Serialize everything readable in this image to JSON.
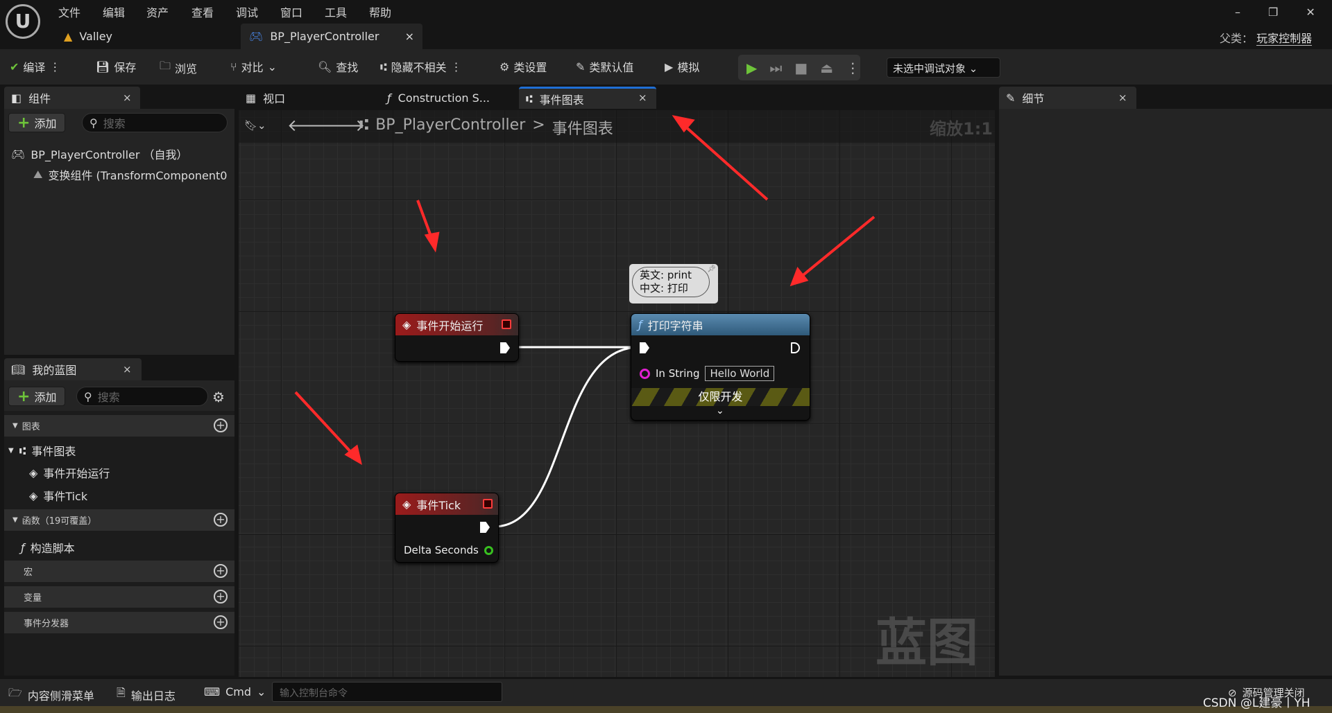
{
  "menu": [
    "文件",
    "编辑",
    "资产",
    "查看",
    "调试",
    "窗口",
    "工具",
    "帮助"
  ],
  "doc_tabs": [
    {
      "label": "Valley"
    },
    {
      "label": "BP_PlayerController",
      "close": "×"
    }
  ],
  "parent_class": {
    "label": "父类：",
    "value": "玩家控制器"
  },
  "toolbar": {
    "compile": "编译",
    "save": "保存",
    "browse": "浏览",
    "diff": "对比",
    "find": "查找",
    "hide_unrelated": "隐藏不相关",
    "class_settings": "类设置",
    "class_defaults": "类默认值",
    "simulate": "模拟",
    "debug_target": "未选中调试对象"
  },
  "panel_tabs": {
    "components": "组件",
    "viewport": "视口",
    "construction": "Construction S...",
    "event_graph": "事件图表",
    "details": "细节",
    "my_blueprint": "我的蓝图"
  },
  "components": {
    "add": "添加",
    "search_placeholder": "搜索",
    "items": [
      "BP_PlayerController （自我）",
      "变换组件 (TransformComponent0"
    ]
  },
  "my_blueprint": {
    "add": "添加",
    "search_placeholder": "搜索",
    "sections": {
      "graphs": "图表",
      "event_graph": "事件图表",
      "begin_play": "事件开始运行",
      "tick": "事件Tick",
      "functions": "函数（19可覆盖）",
      "construction_script": "构造脚本",
      "macros": "宏",
      "variables": "变量",
      "dispatchers": "事件分发器"
    }
  },
  "graph": {
    "breadcrumb_root": "BP_PlayerController",
    "breadcrumb_sep": ">",
    "breadcrumb_current": "事件图表",
    "zoom": "缩放1:1",
    "watermark": "蓝图",
    "nodes": {
      "begin_play": "事件开始运行",
      "tick": "事件Tick",
      "tick_pin": "Delta Seconds",
      "print": "打印字符串",
      "print_icon": "ƒ",
      "in_string_label": "In String",
      "in_string_value": "Hello World",
      "dev_only": "仅限开发"
    },
    "comment": {
      "line1": "英文: print",
      "line2": "中文: 打印"
    }
  },
  "bottom": {
    "content_drawer": "内容侧滑菜单",
    "output_log": "输出日志",
    "cmd": "Cmd",
    "console_placeholder": "输入控制台命令",
    "source_control": "源码管理关闭",
    "watermark": "CSDN @L建豪丨YH"
  },
  "colors": {
    "accent": "#1f6fd6",
    "event_red": "#9a1b1b",
    "function_blue": "#4a7ea3",
    "annotation_arrow": "#ff3030",
    "string_pin": "#e020d0",
    "float_pin": "#38c020"
  }
}
